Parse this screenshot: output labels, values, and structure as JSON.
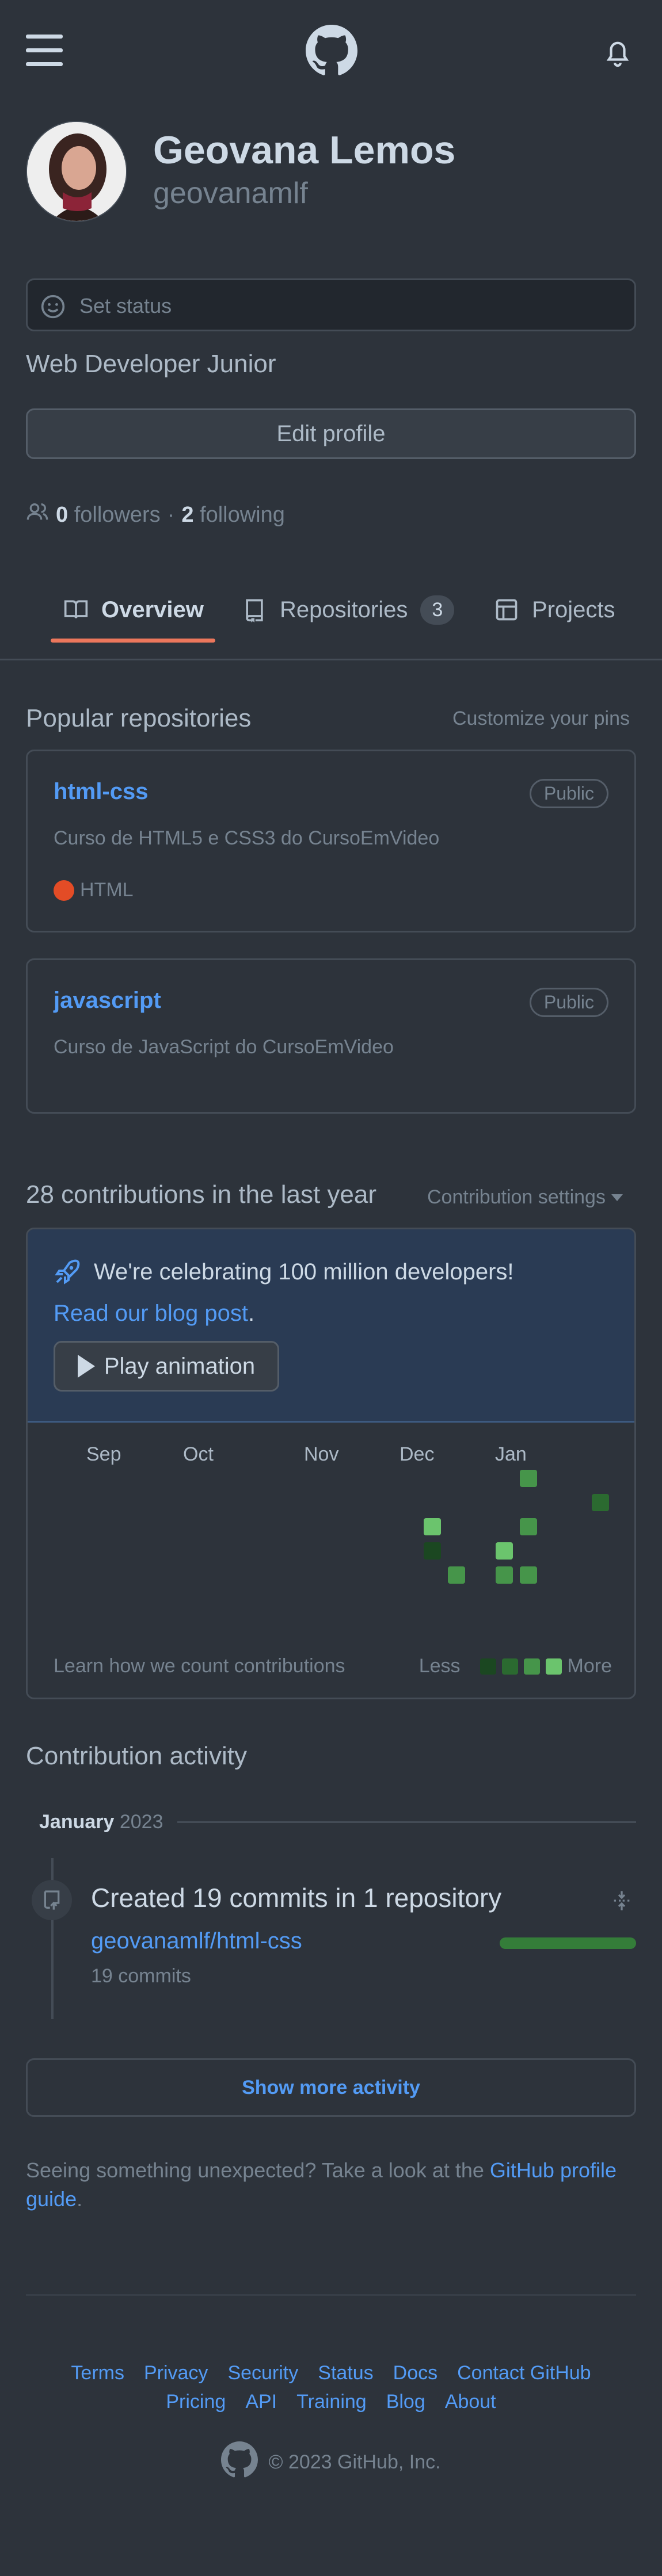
{
  "profile": {
    "name": "Geovana Lemos",
    "login": "geovanamlf",
    "status_placeholder": "Set status",
    "bio": "Web Developer Junior",
    "edit_label": "Edit profile",
    "followers_count": "0",
    "followers_label": "followers",
    "separator": "·",
    "following_count": "2",
    "following_label": "following"
  },
  "tabs": [
    {
      "label": "Overview",
      "active": true
    },
    {
      "label": "Repositories",
      "count": "3"
    },
    {
      "label": "Projects"
    }
  ],
  "popular": {
    "title": "Popular repositories",
    "customize": "Customize your pins",
    "repos": [
      {
        "name": "html-css",
        "visibility": "Public",
        "description": "Curso de HTML5 e CSS3 do CursoEmVideo",
        "language": "HTML",
        "language_color": "#e34c26"
      },
      {
        "name": "javascript",
        "visibility": "Public",
        "description": "Curso de JavaScript do CursoEmVideo"
      }
    ]
  },
  "contributions": {
    "title": "28 contributions in the last year",
    "settings": "Contribution settings",
    "banner_text": "We're celebrating 100 million developers!",
    "blog_link": "Read our blog post",
    "blog_period": ".",
    "play_label": "Play animation",
    "months": [
      "Sep",
      "Oct",
      "Nov",
      "Dec",
      "Jan"
    ],
    "learn_link": "Learn how we count contributions",
    "less": "Less",
    "more": "More",
    "level_colors": [
      "#1b4721",
      "#2b6a30",
      "#46954a",
      "#6bc46d"
    ]
  },
  "activity": {
    "title": "Contribution activity",
    "month": "January",
    "year": "2023",
    "commit_title": "Created 19 commits in 1 repository",
    "commit_repo": "geovanamlf/html-css",
    "commit_count": "19 commits",
    "show_more": "Show more activity"
  },
  "notice": {
    "text": "Seeing something unexpected? Take a look at the ",
    "link": "GitHub profile guide",
    "end": "."
  },
  "footer": {
    "links_row1": [
      "Terms",
      "Privacy",
      "Security",
      "Status",
      "Docs",
      "Contact GitHub"
    ],
    "links_row2": [
      "Pricing",
      "API",
      "Training",
      "Blog",
      "About"
    ],
    "copyright": "© 2023 GitHub, Inc."
  },
  "colors": {
    "background": "#2d333b",
    "link": "#539bf5",
    "tab_accent": "#ec775c",
    "banner": "#2a3b54"
  }
}
